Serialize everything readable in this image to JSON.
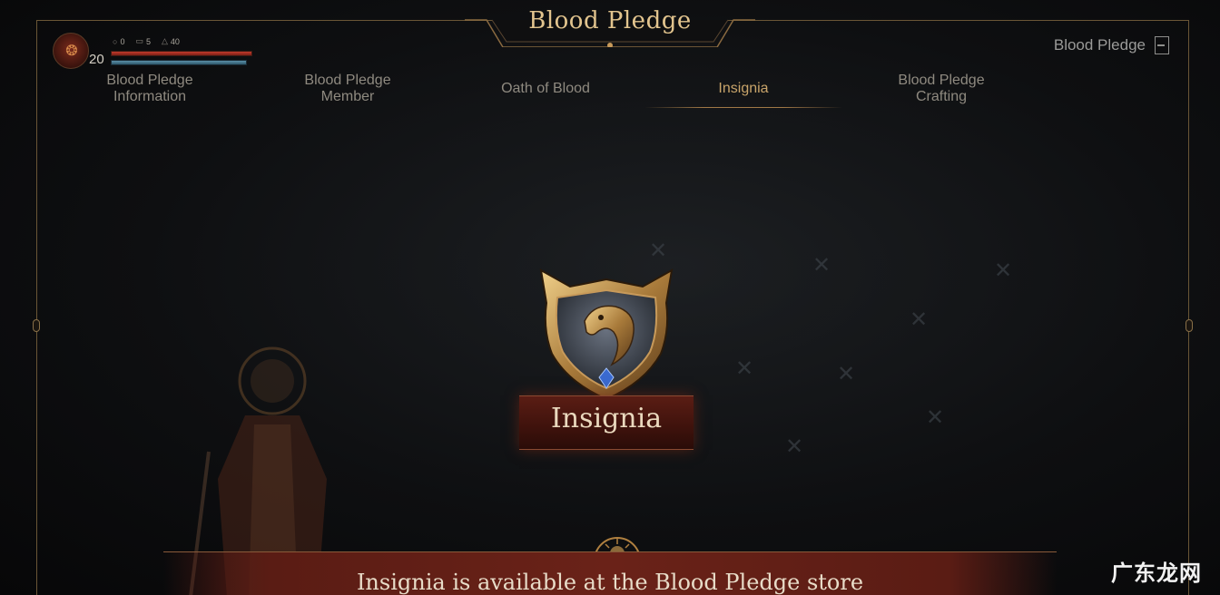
{
  "window": {
    "title": "Blood Pledge",
    "topright_label": "Blood Pledge"
  },
  "player": {
    "level": "20",
    "stats": [
      {
        "icon": "ring-icon",
        "value": "0"
      },
      {
        "icon": "bag-icon",
        "value": "5"
      },
      {
        "icon": "weight-icon",
        "value": "40"
      }
    ],
    "hp_fill": 1.0,
    "mp_fill": 1.0
  },
  "tabs": [
    {
      "line1": "Blood Pledge",
      "line2": "Information",
      "active": false
    },
    {
      "line1": "Blood Pledge",
      "line2": "Member",
      "active": false
    },
    {
      "line1": "Oath of Blood",
      "line2": "",
      "active": false
    },
    {
      "line1": "Insignia",
      "line2": "",
      "active": true
    },
    {
      "line1": "Blood Pledge",
      "line2": "Crafting",
      "active": false
    }
  ],
  "main": {
    "emblem_label": "Insignia",
    "banner_text": "Insignia is available at the Blood Pledge store"
  },
  "watermark": "广东龙网",
  "colors": {
    "accent_gold": "#c8a46a",
    "banner_red": "#6a2218",
    "background": "#0b0c0e"
  }
}
